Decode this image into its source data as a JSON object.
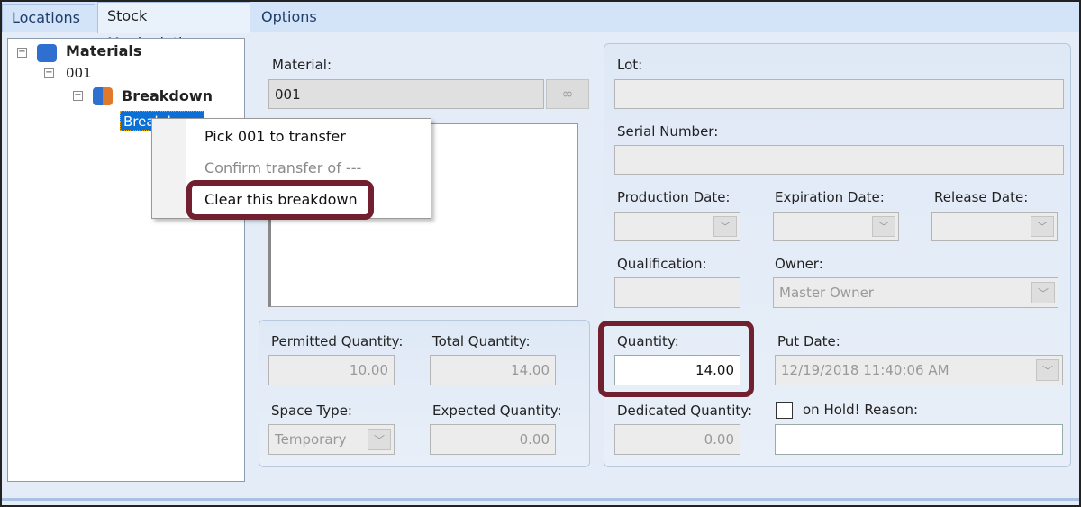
{
  "tabs": [
    {
      "label": "Locations"
    },
    {
      "label": "Stock Manipulation",
      "selected": true
    },
    {
      "label": "Options"
    }
  ],
  "tree": {
    "root": "Materials",
    "child": "001",
    "group": "Breakdown",
    "leaf": "Breakdown"
  },
  "context_menu": {
    "items": [
      {
        "label": "Pick 001 to transfer",
        "enabled": true
      },
      {
        "label": "Confirm transfer of ---",
        "enabled": false
      },
      {
        "label": "Clear this breakdown",
        "enabled": true,
        "highlighted": true
      }
    ]
  },
  "material": {
    "label": "Material:",
    "value": "001"
  },
  "quantities": {
    "permitted_label": "Permitted Quantity:",
    "permitted": "10.00",
    "total_label": "Total Quantity:",
    "total": "14.00",
    "space_type_label": "Space Type:",
    "space_type": "Temporary",
    "expected_label": "Expected Quantity:",
    "expected": "0.00"
  },
  "details": {
    "lot_label": "Lot:",
    "lot": "",
    "serial_label": "Serial Number:",
    "serial": "",
    "production_label": "Production Date:",
    "expiration_label": "Expiration Date:",
    "release_label": "Release Date:",
    "qualification_label": "Qualification:",
    "owner_label": "Owner:",
    "owner": "Master Owner",
    "quantity_label": "Quantity:",
    "quantity": "14.00",
    "put_date_label": "Put Date:",
    "put_date": "12/19/2018 11:40:06 AM",
    "dedicated_label": "Dedicated Quantity:",
    "dedicated": "0.00",
    "on_hold_label": "on Hold! Reason:",
    "on_hold": false,
    "reason": ""
  },
  "colors": {
    "highlight": "#722030",
    "selection": "#0b6fd6"
  }
}
